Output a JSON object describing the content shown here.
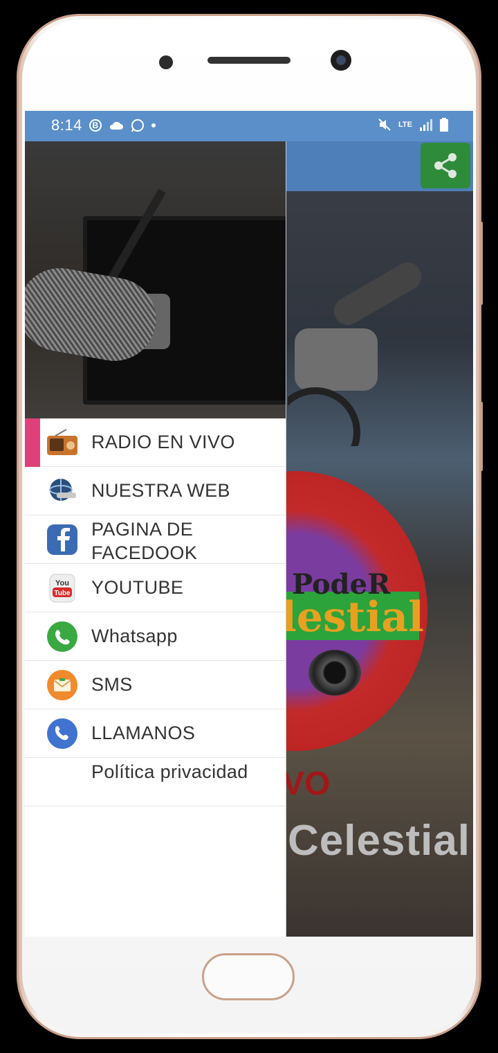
{
  "status_bar": {
    "time": "8:14",
    "b_badge": "B",
    "network": "LTE"
  },
  "drawer": {
    "items": [
      {
        "label": "RADIO EN VIVO",
        "icon": "radio-icon",
        "active": true
      },
      {
        "label": "NUESTRA WEB",
        "icon": "globe-icon",
        "active": false
      },
      {
        "label": "PAGINA DE FACEDOOK",
        "icon": "facebook-icon",
        "active": false
      },
      {
        "label": "YOUTUBE",
        "icon": "youtube-icon",
        "active": false
      },
      {
        "label": "Whatsapp",
        "icon": "whatsapp-icon",
        "active": false
      },
      {
        "label": "SMS",
        "icon": "sms-icon",
        "active": false
      },
      {
        "label": "LLAMANOS",
        "icon": "phone-call-icon",
        "active": false
      },
      {
        "label": "Política privacidad",
        "icon": "",
        "active": false
      }
    ]
  },
  "background_logo": {
    "line1": "PodeR",
    "line2": "lestial",
    "line3": "VO",
    "line4": "Celestial"
  },
  "colors": {
    "status_bar": "#5b8fc9",
    "toolbar": "#4f7fb8",
    "share_button": "#2e8b3a",
    "active_indicator": "#e0407a"
  }
}
